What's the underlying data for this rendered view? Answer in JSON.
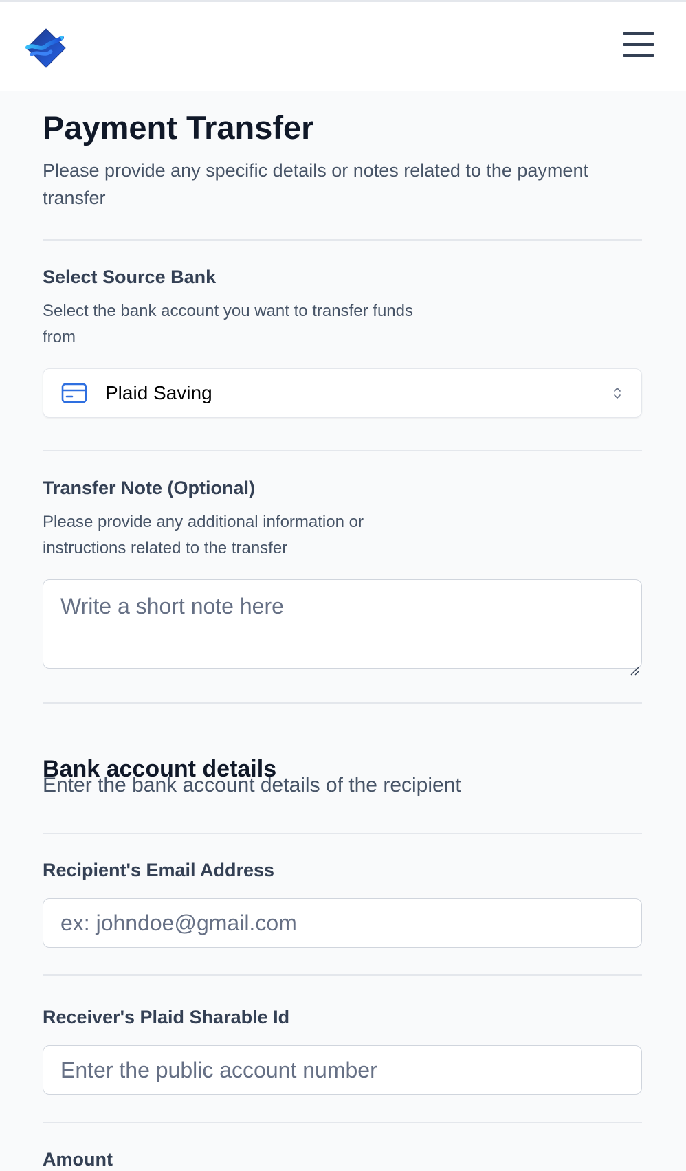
{
  "header": {
    "logo_icon": "app-logo-icon",
    "menu_icon": "hamburger-menu-icon"
  },
  "page": {
    "title": "Payment Transfer",
    "subtitle": "Please provide any specific details or notes related to the payment transfer"
  },
  "source_bank": {
    "label": "Select Source Bank",
    "help": "Select the bank account you want to transfer funds from",
    "selected": "Plaid Saving",
    "icon": "credit-card-icon"
  },
  "transfer_note": {
    "label": "Transfer Note (Optional)",
    "help": "Please provide any additional information or instructions related to the transfer",
    "placeholder": "Write a short note here"
  },
  "bank_details": {
    "heading": "Bank account details",
    "description": "Enter the bank account details of the recipient"
  },
  "recipient_email": {
    "label": "Recipient's Email Address",
    "placeholder": "ex: johndoe@gmail.com"
  },
  "sharable_id": {
    "label": "Receiver's Plaid Sharable Id",
    "placeholder": "Enter the public account number"
  },
  "amount": {
    "label": "Amount"
  },
  "colors": {
    "accent": "#2e6fe0",
    "background": "#f9fafb",
    "header_bg": "#ffffff",
    "divider": "#e4e7ec"
  }
}
